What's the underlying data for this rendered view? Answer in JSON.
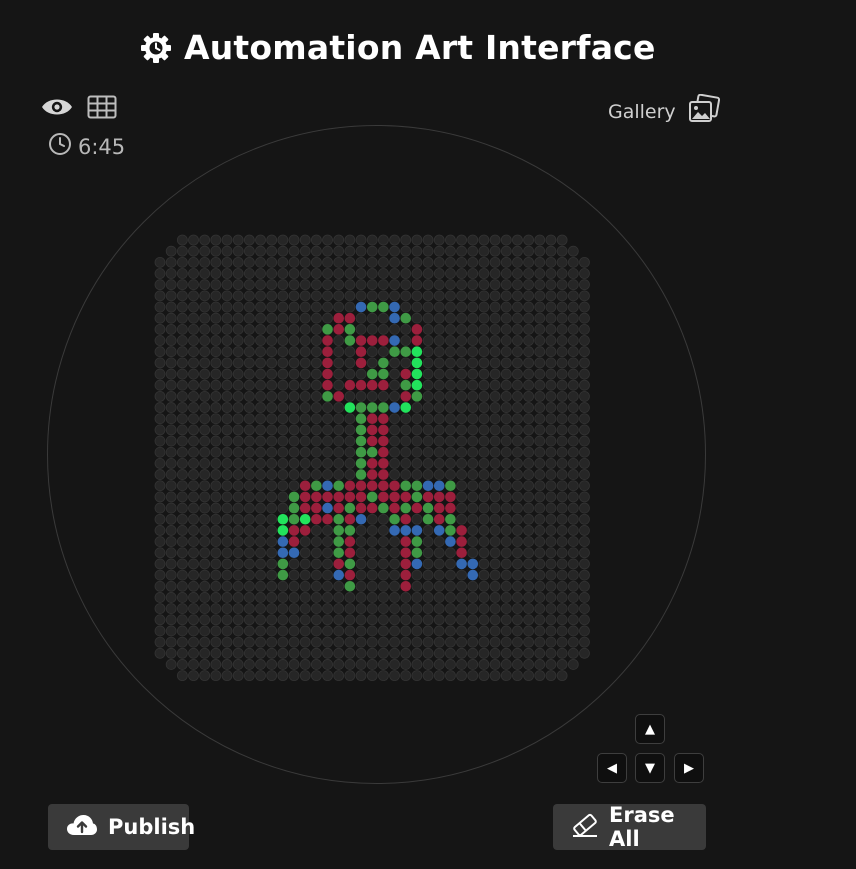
{
  "app": {
    "title": "Automation Art Interface",
    "timer": "6:45",
    "gallery_label": "Gallery",
    "publish_label": "Publish",
    "erase_label": "Erase All"
  },
  "icons": {
    "logo": "gear-badge-icon",
    "view": "eye-icon",
    "grid": "grid-icon",
    "timer": "clock-icon",
    "gallery": "photo-stack-icon",
    "publish": "cloud-upload-icon",
    "erase": "eraser-icon"
  },
  "arrows": {
    "up": "▲",
    "down": "▼",
    "left": "◀",
    "right": "▶"
  },
  "colors": {
    "background": "#151515",
    "empty_peg": "#262626",
    "empty_peg_stroke": "#333333",
    "red": "#9c1f3c",
    "green": "#3f9a45",
    "blue": "#3469b3",
    "bright_green": "#22e35c"
  },
  "canvas": {
    "columns": 39,
    "rows": 40,
    "legend": {
      "R": "red",
      "G": "green",
      "B": "blue",
      "L": "bright_green"
    },
    "pixels": [
      "",
      "",
      "",
      "",
      "",
      "",
      "",
      "",
      "",
      "",
      "",
      "",
      "",
      "",
      "",
      "",
      "",
      "",
      "",
      "",
      "",
      "",
      "",
      "",
      "",
      "",
      "",
      "",
      "",
      "",
      "",
      "",
      "",
      "",
      "",
      "",
      "",
      "",
      "",
      ""
    ]
  }
}
